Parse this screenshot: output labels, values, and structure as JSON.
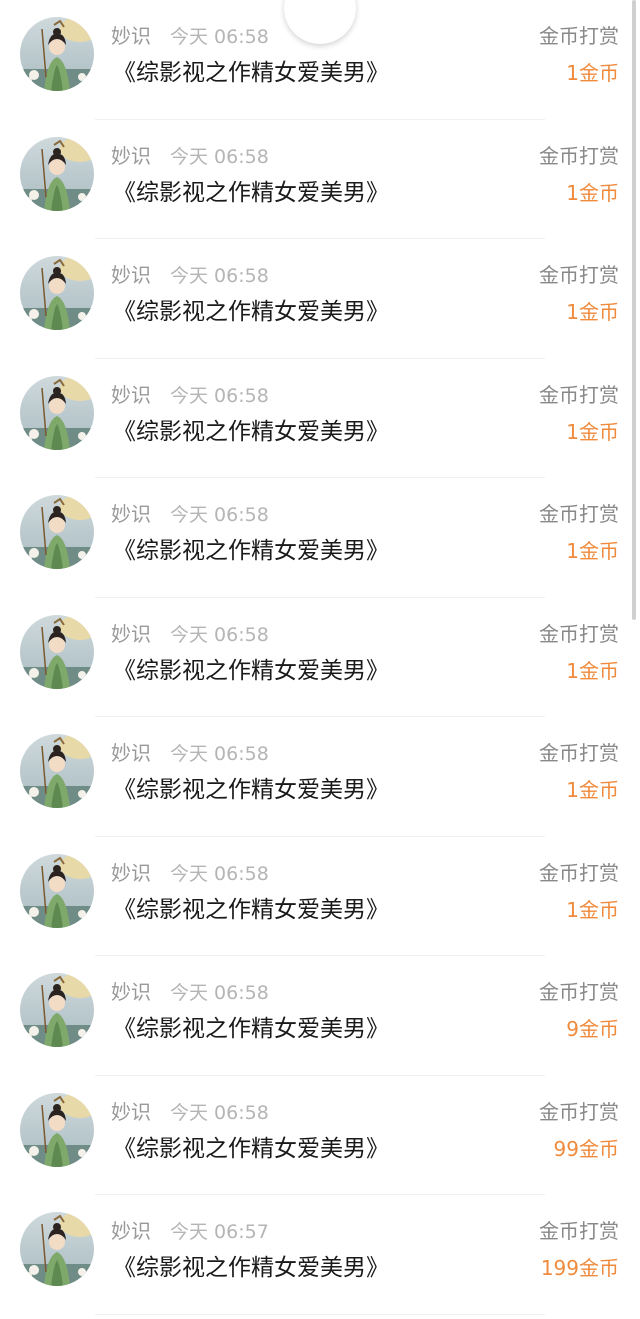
{
  "records": [
    {
      "user": "妙识",
      "time": "今天 06:58",
      "book": "《综影视之作精女爱美男》",
      "type": "金币打赏",
      "amount": "1金币"
    },
    {
      "user": "妙识",
      "time": "今天 06:58",
      "book": "《综影视之作精女爱美男》",
      "type": "金币打赏",
      "amount": "1金币"
    },
    {
      "user": "妙识",
      "time": "今天 06:58",
      "book": "《综影视之作精女爱美男》",
      "type": "金币打赏",
      "amount": "1金币"
    },
    {
      "user": "妙识",
      "time": "今天 06:58",
      "book": "《综影视之作精女爱美男》",
      "type": "金币打赏",
      "amount": "1金币"
    },
    {
      "user": "妙识",
      "time": "今天 06:58",
      "book": "《综影视之作精女爱美男》",
      "type": "金币打赏",
      "amount": "1金币"
    },
    {
      "user": "妙识",
      "time": "今天 06:58",
      "book": "《综影视之作精女爱美男》",
      "type": "金币打赏",
      "amount": "1金币"
    },
    {
      "user": "妙识",
      "time": "今天 06:58",
      "book": "《综影视之作精女爱美男》",
      "type": "金币打赏",
      "amount": "1金币"
    },
    {
      "user": "妙识",
      "time": "今天 06:58",
      "book": "《综影视之作精女爱美男》",
      "type": "金币打赏",
      "amount": "1金币"
    },
    {
      "user": "妙识",
      "time": "今天 06:58",
      "book": "《综影视之作精女爱美男》",
      "type": "金币打赏",
      "amount": "9金币"
    },
    {
      "user": "妙识",
      "time": "今天 06:58",
      "book": "《综影视之作精女爱美男》",
      "type": "金币打赏",
      "amount": "99金币"
    },
    {
      "user": "妙识",
      "time": "今天 06:57",
      "book": "《综影视之作精女爱美男》",
      "type": "金币打赏",
      "amount": "199金币"
    }
  ],
  "colors": {
    "amount": "#f08a3c",
    "name": "#999999",
    "time": "#b5b5b5",
    "title": "#1a1a1a"
  },
  "icons": {
    "avatar": "avatar-portrait-icon"
  }
}
